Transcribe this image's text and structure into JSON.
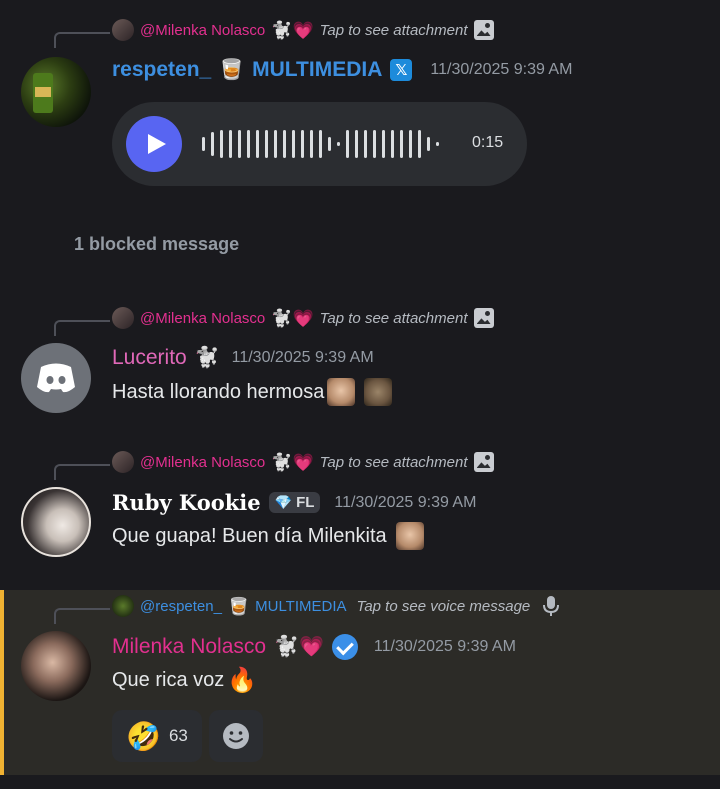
{
  "messages": [
    {
      "reply": {
        "name": "@Milenka Nolasco",
        "emoji": "🐩💗",
        "text": "Tap to see attachment"
      },
      "author": "respeten_",
      "author_emoji": "🥃",
      "author_suffix": "MULTIMEDIA",
      "author_badge": "𝕏",
      "timestamp": "11/30/2025 9:39 AM",
      "voice": {
        "duration": "0:15"
      }
    },
    {
      "reply": {
        "name": "@Milenka Nolasco",
        "emoji": "🐩💗",
        "text": "Tap to see attachment"
      },
      "author": "Lucerito",
      "author_emoji": "🐩",
      "timestamp": "11/30/2025 9:39 AM",
      "text": "Hasta llorando hermosa"
    },
    {
      "reply": {
        "name": "@Milenka Nolasco",
        "emoji": "🐩💗",
        "text": "Tap to see attachment"
      },
      "author": "Ruby Kookie",
      "badge_label": "FL",
      "timestamp": "11/30/2025 9:39 AM",
      "text": "Que guapa! Buen día Milenkita"
    },
    {
      "reply": {
        "name": "@respeten_",
        "emoji": "🥃",
        "suffix": "MULTIMEDIA",
        "text": "Tap to see voice message"
      },
      "author": "Milenka Nolasco",
      "author_emoji": "🐩💗",
      "timestamp": "11/30/2025 9:39 AM",
      "text": "Que rica voz",
      "text_emoji": "🔥",
      "reactions": [
        {
          "emoji": "🤣",
          "count": "63"
        }
      ]
    }
  ],
  "blocked": "1 blocked message",
  "colors": {
    "accent": "#5865f2",
    "pink": "#e2308f",
    "blue": "#3d8fe0",
    "highlight_border": "#f0b232"
  }
}
